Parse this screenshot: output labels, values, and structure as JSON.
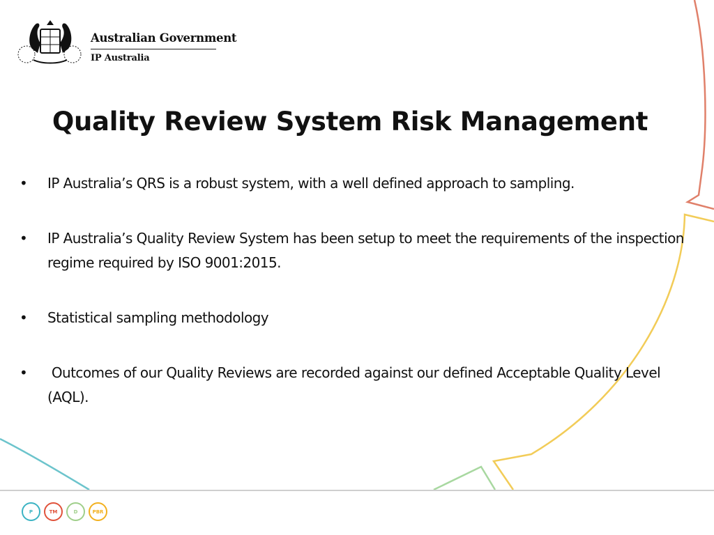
{
  "header": {
    "government_name": "Australian Government",
    "agency_name": "IP Australia",
    "crest_icon": "coat-of-arms-icon"
  },
  "slide": {
    "title": "Quality Review System Risk Management",
    "bullets": [
      {
        "text": "IP Australia’s QRS is a robust system, with a well defined approach to sampling."
      },
      {
        "text": "IP Australia’s Quality Review System has been setup to meet the requirements of the inspection regime required by ISO 9001:2015."
      },
      {
        "text": "Statistical sampling methodology"
      },
      {
        "text": " Outcomes of our Quality Reviews are recorded against our defined Acceptable Quality Level (AQL)."
      }
    ]
  },
  "footer": {
    "icons": [
      {
        "label": "P",
        "color": "#3bb3c3",
        "icon": "patents-icon"
      },
      {
        "label": "TM",
        "color": "#e0523a",
        "icon": "trade-marks-icon"
      },
      {
        "label": "D",
        "color": "#9fcf8a",
        "icon": "designs-icon"
      },
      {
        "label": "PBR",
        "color": "#f2b01e",
        "icon": "plant-breeders-rights-icon"
      }
    ]
  },
  "colors": {
    "decor_red": "#e0806a",
    "decor_yellow": "#f2cc58",
    "decor_green": "#a8d8a0",
    "decor_teal": "#6cc4cc"
  }
}
